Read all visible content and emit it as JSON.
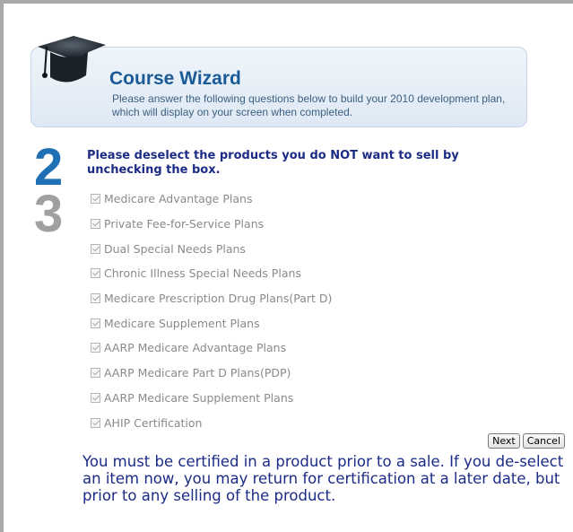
{
  "header": {
    "title": "Course Wizard",
    "subtitle": "Please answer the following questions below to build your 2010 development plan, which will display on your screen when completed."
  },
  "steps": {
    "current": "2",
    "next": "3"
  },
  "instruction": "Please deselect the products you do NOT want to sell by unchecking the box.",
  "products": [
    {
      "label": "Medicare Advantage Plans",
      "checked": true,
      "disabled": true
    },
    {
      "label": "Private Fee-for-Service Plans",
      "checked": true,
      "disabled": true
    },
    {
      "label": "Dual Special Needs Plans",
      "checked": true,
      "disabled": true
    },
    {
      "label": "Chronic Illness Special Needs Plans",
      "checked": true,
      "disabled": true
    },
    {
      "label": "Medicare Prescription Drug Plans(Part D)",
      "checked": true,
      "disabled": true
    },
    {
      "label": "Medicare Supplement Plans",
      "checked": true,
      "disabled": true
    },
    {
      "label": "AARP Medicare Advantage Plans",
      "checked": true,
      "disabled": true
    },
    {
      "label": "AARP Medicare Part D Plans(PDP)",
      "checked": true,
      "disabled": true
    },
    {
      "label": "AARP Medicare Supplement Plans",
      "checked": true,
      "disabled": true
    },
    {
      "label": "AHIP Certification",
      "checked": true,
      "disabled": true
    }
  ],
  "buttons": {
    "next": "Next",
    "cancel": "Cancel"
  },
  "notice": "You must be certified in a product prior to a sale. If you de-select an item now, you may return for certification at a later date, but prior to any selling of the product.",
  "colors": {
    "accent": "#1f6fb4",
    "text_dark_blue": "#1c2c86",
    "muted": "#a0a0a0"
  },
  "icons": {
    "header": "graduation-cap-icon"
  }
}
